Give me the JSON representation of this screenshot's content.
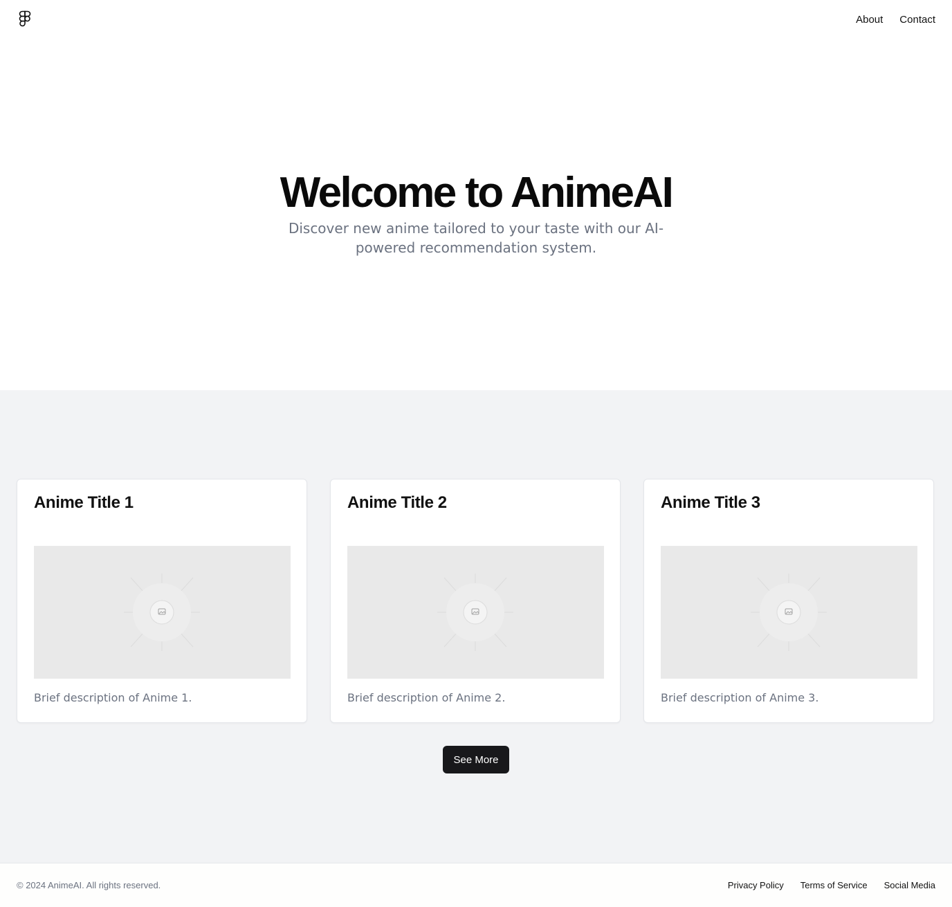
{
  "header": {
    "logo_icon": "figma-logo-icon",
    "nav": [
      {
        "label": "About"
      },
      {
        "label": "Contact"
      }
    ]
  },
  "hero": {
    "title": "Welcome to AnimeAI",
    "subtitle": "Discover new anime tailored to your taste with our AI-powered recommendation system."
  },
  "cards": [
    {
      "title": "Anime Title 1",
      "image_icon": "image-placeholder-icon",
      "description": "Brief description of Anime 1."
    },
    {
      "title": "Anime Title 2",
      "image_icon": "image-placeholder-icon",
      "description": "Brief description of Anime 2."
    },
    {
      "title": "Anime Title 3",
      "image_icon": "image-placeholder-icon",
      "description": "Brief description of Anime 3."
    }
  ],
  "see_more_label": "See More",
  "footer": {
    "copyright": "© 2024 AnimeAI. All rights reserved.",
    "links": [
      {
        "label": "Privacy Policy"
      },
      {
        "label": "Terms of Service"
      },
      {
        "label": "Social Media"
      }
    ]
  },
  "colors": {
    "section_bg": "#f2f3f5",
    "button_bg": "#18181b",
    "muted_text": "#6b7280",
    "placeholder_bg": "#e9e9e9"
  }
}
